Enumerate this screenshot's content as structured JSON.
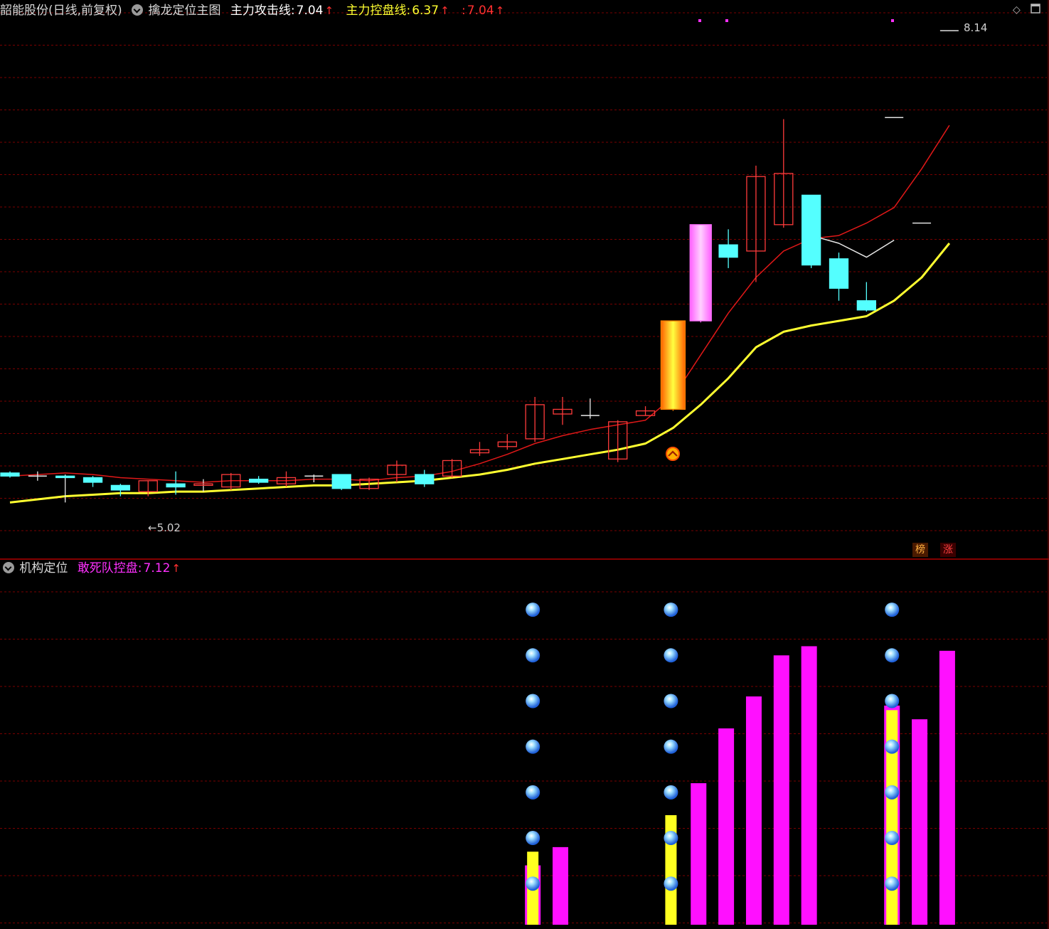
{
  "main_pane": {
    "stock_title": "韶能股份(日线,前复权)",
    "indicator_name": "擒龙定位主图",
    "attack_label": "主力攻击线:",
    "attack_value": "7.04",
    "control_label": "主力控盘线:",
    "control_value": "6.37",
    "extra_label": ":",
    "extra_value": "7.04",
    "up_arrow": "↑",
    "high_price_label": "8.14",
    "low_price_label": "←5.02",
    "badge_rank": "榜",
    "badge_rise": "涨"
  },
  "sub_pane": {
    "indicator_name": "机构定位",
    "series_label": "敢死队控盘:",
    "series_value": "7.12",
    "up_arrow": "↑"
  },
  "colors": {
    "up": "#ff3b3b",
    "down": "#54ffff",
    "attack_line": "#e01818",
    "control_line": "#ffff30",
    "grid": "#7a0000",
    "magenta": "#ff10ff",
    "yellow": "#ffff20"
  },
  "chart_data": {
    "type": "candlestick",
    "price_axis": {
      "min": 4.9,
      "max": 8.2
    },
    "candles": [
      {
        "o": 5.29,
        "h": 5.3,
        "l": 5.26,
        "c": 5.27
      },
      {
        "o": 5.27,
        "h": 5.3,
        "l": 5.24,
        "c": 5.27
      },
      {
        "o": 5.27,
        "h": 5.28,
        "l": 5.1,
        "c": 5.26
      },
      {
        "o": 5.26,
        "h": 5.27,
        "l": 5.2,
        "c": 5.23
      },
      {
        "o": 5.21,
        "h": 5.22,
        "l": 5.14,
        "c": 5.18
      },
      {
        "o": 5.17,
        "h": 5.24,
        "l": 5.14,
        "c": 5.24
      },
      {
        "o": 5.22,
        "h": 5.3,
        "l": 5.15,
        "c": 5.2
      },
      {
        "o": 5.21,
        "h": 5.25,
        "l": 5.17,
        "c": 5.22
      },
      {
        "o": 5.2,
        "h": 5.29,
        "l": 5.18,
        "c": 5.28
      },
      {
        "o": 5.25,
        "h": 5.27,
        "l": 5.22,
        "c": 5.23
      },
      {
        "o": 5.22,
        "h": 5.3,
        "l": 5.2,
        "c": 5.26
      },
      {
        "o": 5.27,
        "h": 5.28,
        "l": 5.23,
        "c": 5.27
      },
      {
        "o": 5.28,
        "h": 5.28,
        "l": 5.18,
        "c": 5.19
      },
      {
        "o": 5.19,
        "h": 5.26,
        "l": 5.18,
        "c": 5.25
      },
      {
        "o": 5.28,
        "h": 5.37,
        "l": 5.23,
        "c": 5.34
      },
      {
        "o": 5.28,
        "h": 5.31,
        "l": 5.2,
        "c": 5.22
      },
      {
        "o": 5.27,
        "h": 5.38,
        "l": 5.26,
        "c": 5.37
      },
      {
        "o": 5.42,
        "h": 5.49,
        "l": 5.4,
        "c": 5.44
      },
      {
        "o": 5.46,
        "h": 5.54,
        "l": 5.44,
        "c": 5.49
      },
      {
        "o": 5.51,
        "h": 5.78,
        "l": 5.49,
        "c": 5.73
      },
      {
        "o": 5.67,
        "h": 5.78,
        "l": 5.6,
        "c": 5.7
      },
      {
        "o": 5.66,
        "h": 5.77,
        "l": 5.64,
        "c": 5.66
      },
      {
        "o": 5.38,
        "h": 5.63,
        "l": 5.36,
        "c": 5.62
      },
      {
        "o": 5.66,
        "h": 5.72,
        "l": 5.66,
        "c": 5.69
      },
      {
        "o": 5.7,
        "h": 6.27,
        "l": 5.69,
        "c": 6.27
      },
      {
        "o": 6.89,
        "h": 6.89,
        "l": 6.26,
        "c": 6.27
      },
      {
        "o": 6.76,
        "h": 6.86,
        "l": 6.61,
        "c": 6.68
      },
      {
        "o": 6.72,
        "h": 7.27,
        "l": 6.52,
        "c": 7.2
      },
      {
        "o": 6.89,
        "h": 7.57,
        "l": 6.87,
        "c": 7.22
      },
      {
        "o": 7.08,
        "h": 7.08,
        "l": 6.61,
        "c": 6.63
      },
      {
        "o": 6.67,
        "h": 6.71,
        "l": 6.4,
        "c": 6.48
      },
      {
        "o": 6.4,
        "h": 6.52,
        "l": 6.33,
        "c": 6.34
      },
      {
        "o": 7.58,
        "h": 7.58,
        "l": 7.58,
        "c": 7.58
      },
      {
        "o": 6.9,
        "h": 6.9,
        "l": 6.9,
        "c": 6.9
      },
      {
        "o": 8.14,
        "h": 8.14,
        "l": 8.14,
        "c": 8.14
      }
    ],
    "attack_line": [
      5.27,
      5.28,
      5.29,
      5.28,
      5.26,
      5.25,
      5.24,
      5.23,
      5.24,
      5.24,
      5.24,
      5.25,
      5.25,
      5.24,
      5.26,
      5.27,
      5.3,
      5.35,
      5.41,
      5.48,
      5.53,
      5.57,
      5.6,
      5.63,
      5.78,
      6.05,
      6.32,
      6.55,
      6.72,
      6.8,
      6.82,
      6.9,
      7.0,
      7.25,
      7.53
    ],
    "control_line": [
      5.1,
      5.12,
      5.14,
      5.15,
      5.16,
      5.16,
      5.17,
      5.17,
      5.18,
      5.19,
      5.2,
      5.21,
      5.21,
      5.22,
      5.23,
      5.24,
      5.26,
      5.28,
      5.31,
      5.35,
      5.38,
      5.41,
      5.44,
      5.48,
      5.58,
      5.73,
      5.9,
      6.1,
      6.2,
      6.24,
      6.27,
      6.3,
      6.4,
      6.55,
      6.77
    ],
    "white_line": [
      null,
      null,
      null,
      null,
      null,
      null,
      null,
      null,
      null,
      null,
      null,
      null,
      null,
      null,
      null,
      null,
      null,
      null,
      null,
      null,
      null,
      null,
      null,
      null,
      null,
      null,
      null,
      null,
      null,
      6.82,
      6.77,
      6.68,
      6.79,
      null,
      null
    ],
    "sub_bars": [
      {
        "i": 19,
        "magenta": 1.3,
        "yellow": 1.6
      },
      {
        "i": 20,
        "magenta": 1.7,
        "yellow": 0
      },
      {
        "i": 24,
        "magenta": 0,
        "yellow": 2.4
      },
      {
        "i": 25,
        "magenta": 3.1,
        "yellow": 0
      },
      {
        "i": 26,
        "magenta": 4.3,
        "yellow": 0
      },
      {
        "i": 27,
        "magenta": 5.0,
        "yellow": 0
      },
      {
        "i": 28,
        "magenta": 5.9,
        "yellow": 0
      },
      {
        "i": 29,
        "magenta": 6.1,
        "yellow": 0
      },
      {
        "i": 32,
        "magenta": 4.8,
        "yellow": 4.7
      },
      {
        "i": 33,
        "magenta": 4.5,
        "yellow": 0
      },
      {
        "i": 34,
        "magenta": 6.0,
        "yellow": 0
      }
    ],
    "sub_axis": {
      "min": 0,
      "max": 7.12
    },
    "dot_columns": [
      19,
      24,
      32
    ],
    "dot_levels": [
      0.9,
      1.9,
      2.9,
      3.9,
      4.9,
      5.9,
      6.9
    ]
  }
}
